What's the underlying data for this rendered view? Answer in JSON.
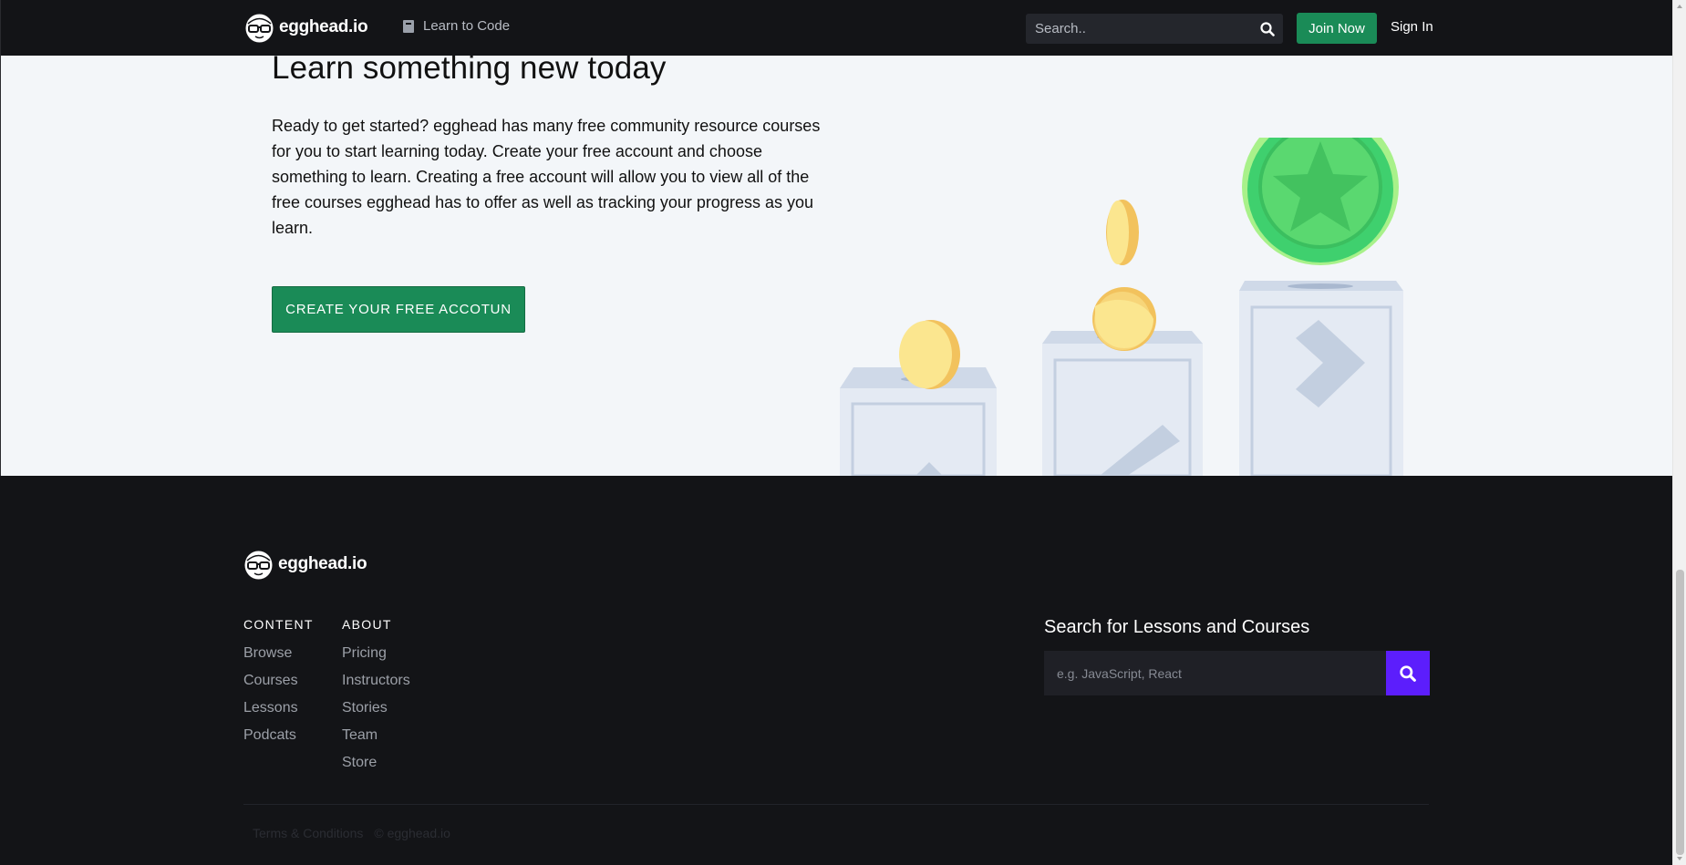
{
  "header": {
    "logo_text": "egghead.io",
    "nav_link": "Learn to Code",
    "search_placeholder": "Search..",
    "join_label": "Join Now",
    "signin_label": "Sign In"
  },
  "hero": {
    "title": "Learn something new today",
    "body": "Ready to get started? egghead has many free community resource courses for you to start learning today. Create your free account and choose something to learn. Creating a free account will allow you to view all of the free courses egghead has to offer as well as tracking your progress as you learn.",
    "cta_label": "CREATE YOUR FREE ACCOTUN"
  },
  "footer": {
    "logo_text": "egghead.io",
    "content_heading": "CONTENT",
    "content_links": [
      "Browse",
      "Courses",
      "Lessons",
      "Podcats"
    ],
    "about_heading": "ABOUT",
    "about_links": [
      "Pricing",
      "Instructors",
      "Stories",
      "Team",
      "Store"
    ],
    "search_title": "Search for Lessons and Courses",
    "search_placeholder": "e.g. JavaScript, React",
    "legal_terms": "Terms & Conditions",
    "legal_copyright": "© egghead.io"
  },
  "icons": {
    "logo": "egghead-logo-icon",
    "book": "book-icon",
    "search": "search-icon"
  },
  "colors": {
    "brand_green": "#1a8b57",
    "search_purple": "#5c1efc",
    "dark_bg": "#131417",
    "hero_bg": "#f3f6f9"
  }
}
